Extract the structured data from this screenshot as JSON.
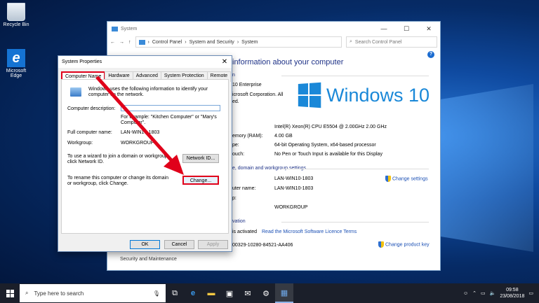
{
  "desktop": {
    "icons": [
      {
        "label": "Recycle Bin",
        "icon": "recycle-bin-icon"
      },
      {
        "label": "Microsoft Edge",
        "icon": "edge-icon"
      }
    ]
  },
  "system_window": {
    "title": "System",
    "breadcrumb": [
      "Control Panel",
      "System and Security",
      "System"
    ],
    "search_placeholder": "Search Control Panel",
    "main_title": "information about your computer",
    "windows_edition_section": "n",
    "edition": "10 Enterprise",
    "copyright": "icrosoft Corporation. All",
    "copyright2": "ed.",
    "system_section": "",
    "logo_text": "Windows 10",
    "rows": [
      {
        "k": "",
        "v": "Intel(R) Xeon(R) CPU        E5504  @ 2.00GHz   2.00 GHz"
      },
      {
        "k": "emory (RAM):",
        "v": "4.00 GB"
      },
      {
        "k": "pe:",
        "v": "64-bit Operating System, x64-based processor"
      },
      {
        "k": "ouch:",
        "v": "No Pen or Touch Input is available for this Display"
      }
    ],
    "name_section": "e, domain and workgroup settings",
    "name_rows": [
      {
        "k": "",
        "v": "LAN-WIN10-1803"
      },
      {
        "k": "uter name:",
        "v": "LAN-WIN10-1803"
      },
      {
        "k": "p:",
        "v": ""
      },
      {
        "k": "",
        "v": "WORKGROUP"
      }
    ],
    "change_settings": "Change settings",
    "activation_section": "vation",
    "activation_text": "is activated",
    "licence_link": "Read the Microsoft Software Licence Terms",
    "product_id": "00329-10280-84521-AA406",
    "change_product_key": "Change product key",
    "see_also": "Security and Maintenance",
    "buttons": {
      "min": "—",
      "max": "☐",
      "close": "✕"
    }
  },
  "dialog": {
    "title": "System Properties",
    "tabs": [
      "Computer Name",
      "Hardware",
      "Advanced",
      "System Protection",
      "Remote"
    ],
    "intro": "Windows uses the following information to identify your computer on the network.",
    "desc_label": "Computer description:",
    "example": "For example: \"Kitchen Computer\" or \"Mary's Computer\".",
    "full_name_label": "Full computer name:",
    "full_name_value": "LAN-WIN10-1803",
    "workgroup_label": "Workgroup:",
    "workgroup_value": "WORKGROUP",
    "wizard_text": "To use a wizard to join a domain or workgroup, click Network ID.",
    "network_id": "Network ID...",
    "rename_text": "To rename this computer or change its domain or workgroup, click Change.",
    "change": "Change...",
    "ok": "OK",
    "cancel": "Cancel",
    "apply": "Apply"
  },
  "taskbar": {
    "search_placeholder": "Type here to search",
    "clock_time": "09:58",
    "clock_date": "23/08/2018"
  }
}
